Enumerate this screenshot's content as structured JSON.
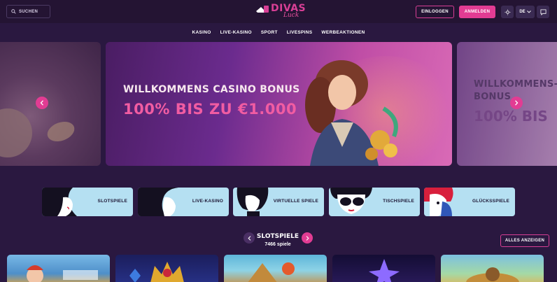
{
  "header": {
    "search_label": "SUCHEN",
    "logo_main": "DIVAS",
    "logo_sub": "Luck",
    "login_label": "EINLOGGEN",
    "register_label": "ANMELDEN",
    "lang_label": "DE",
    "icons": [
      "search-icon",
      "sun-icon",
      "chevron-down-icon",
      "chat-icon"
    ]
  },
  "nav": {
    "items": [
      "KASINO",
      "LIVE-KASINO",
      "SPORT",
      "LIVESPINS",
      "WERBEAKTIONEN"
    ]
  },
  "banner": {
    "main_title": "WILLKOMMENS CASINO BONUS",
    "main_offer": "100% BIS ZU €1.000",
    "right_title": "WILLKOMMENS-LIVE BONUS",
    "right_offer": "100% BIS",
    "prev_icon": "chevron-left-icon",
    "next_icon": "chevron-right-icon"
  },
  "categories": [
    {
      "label": "SLOTSPIELE"
    },
    {
      "label": "LIVE-KASINO"
    },
    {
      "label": "VIRTUELLE SPIELE"
    },
    {
      "label": "TISCHSPIELE"
    },
    {
      "label": "GLÜCKSSPIELE"
    }
  ],
  "slots_section": {
    "title": "SLOTSPIELE",
    "count": "7466 spiele",
    "show_all_label": "ALLES ANZEIGEN"
  },
  "colors": {
    "background": "#2a1840",
    "header": "#241433",
    "accent": "#e23c93",
    "tile": "#b5e0f2"
  }
}
